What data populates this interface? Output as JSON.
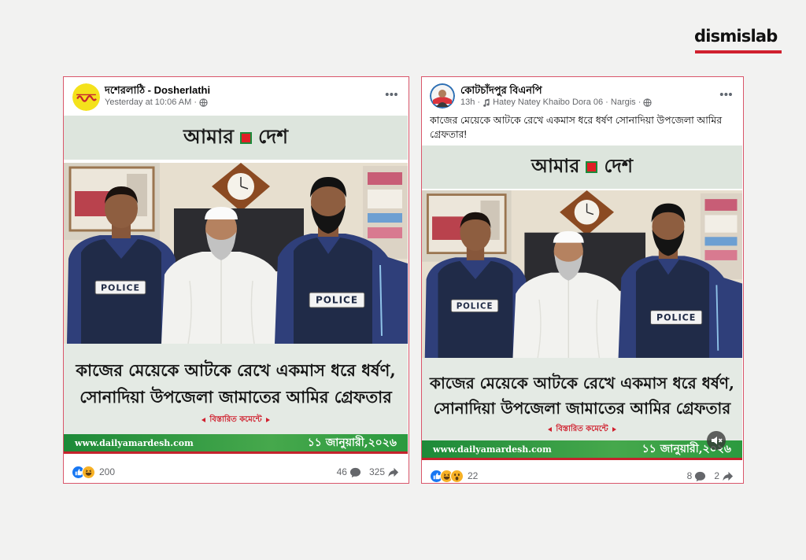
{
  "brand": {
    "logo": "dismislab",
    "accent_color": "#d0202e"
  },
  "colors": {
    "card_border": "#d9566a",
    "facebook_blue": "#1877f2",
    "news_green": "#1f8b3b",
    "news_red": "#e01e25"
  },
  "photo": {
    "vest_label": "POLICE"
  },
  "posts": [
    {
      "page_name": "দশেরলাঠি - Dosherlathi",
      "meta_time": "Yesterday at 10:06 AM ·",
      "news_card": {
        "masthead_left": "আমার",
        "masthead_right": "দেশ",
        "headline_line1": "কাজের মেয়েকে আটকে রেখে একমাস ধরে ধর্ষণ,",
        "headline_line2": "সোনাদিয়া উপজেলা জামাতের আমির গ্রেফতার",
        "details_hint": "বিস্তারিত কমেন্টে",
        "website": "www.dailyamardesh.com",
        "date": "১১ জানুয়ারী,২০২৬"
      },
      "reactions": {
        "types": [
          "like-icon",
          "haha-icon"
        ],
        "count": "200"
      },
      "comments": "46",
      "shares": "325"
    },
    {
      "page_name": "কোটচাঁদপুর বিএনপি",
      "meta_time": "13h ·",
      "meta_audio": "Hatey Natey Khaibo Dora 06 · Nargis ·",
      "text": "কাজের মেয়েকে আটকে রেখে  একমাস ধরে ধর্ষণ সোনাদিয়া উপজেলা আমির গ্রেফতার!",
      "news_card": {
        "masthead_left": "আমার",
        "masthead_right": "দেশ",
        "headline_line1": "কাজের মেয়েকে আটকে রেখে একমাস ধরে ধর্ষণ,",
        "headline_line2": "সোনাদিয়া উপজেলা জামাতের আমির গ্রেফতার",
        "details_hint": "বিস্তারিত কমেন্টে",
        "website": "www.dailyamardesh.com",
        "date": "১১ জানুয়ারী,২০২৬"
      },
      "reactions": {
        "types": [
          "like-icon",
          "haha-icon",
          "wow-icon"
        ],
        "count": "22"
      },
      "comments": "8",
      "shares": "2"
    }
  ]
}
